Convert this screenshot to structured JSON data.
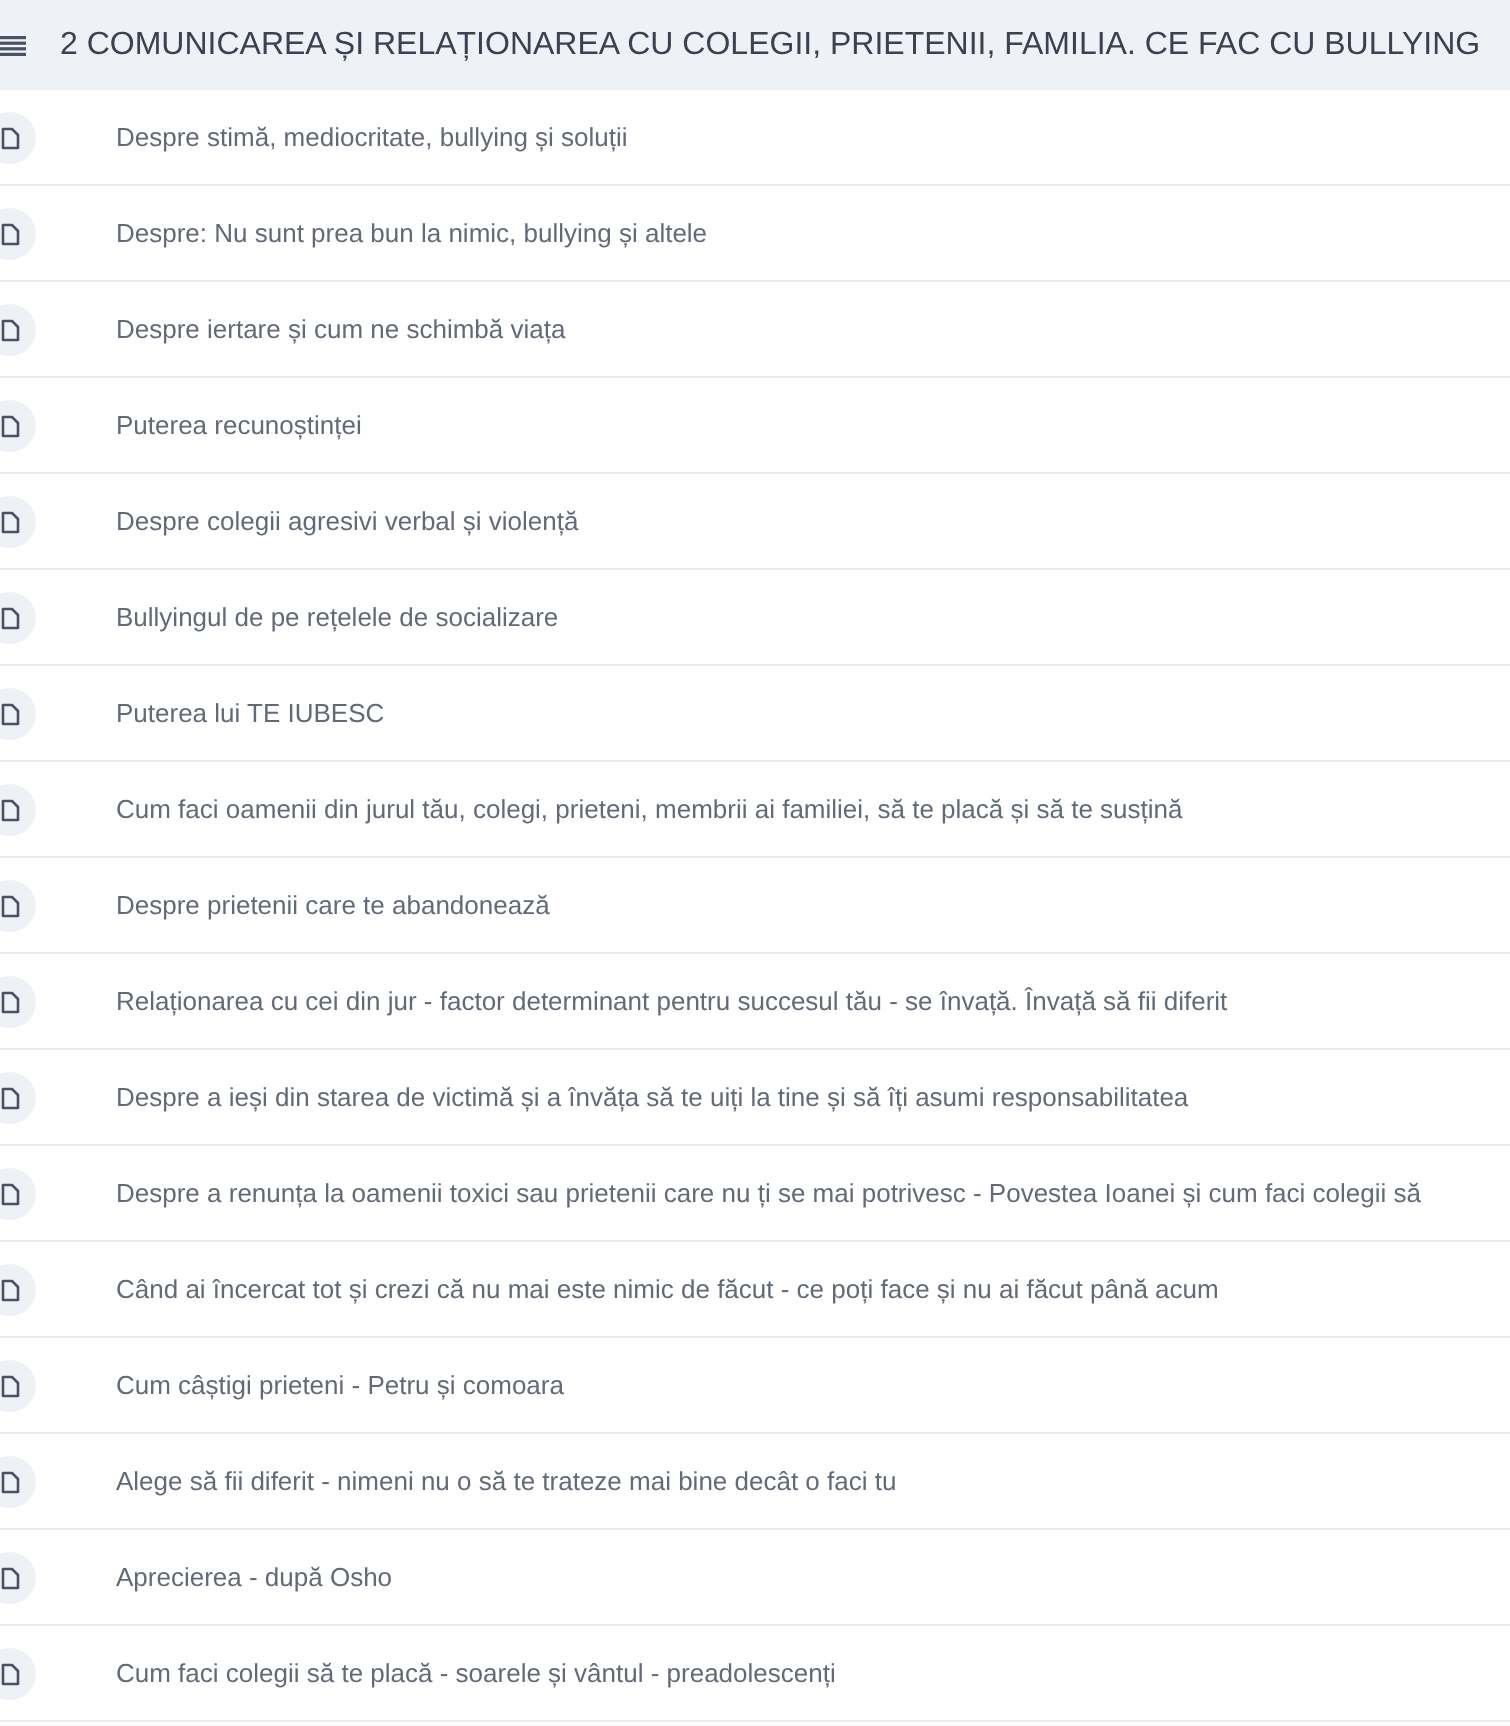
{
  "section": {
    "title": "2 COMUNICAREA ȘI RELAȚIONAREA CU COLEGII, PRIETENII, FAMILIA. CE FAC CU BULLYING"
  },
  "lessons": [
    {
      "title": "Despre stimă, mediocritate, bullying și soluții"
    },
    {
      "title": "Despre: Nu sunt prea bun la nimic, bullying și altele"
    },
    {
      "title": "Despre iertare și cum ne schimbă viața"
    },
    {
      "title": "Puterea recunoștinței"
    },
    {
      "title": "Despre colegii agresivi verbal și violență"
    },
    {
      "title": "Bullyingul de pe rețelele de socializare"
    },
    {
      "title": "Puterea lui TE IUBESC"
    },
    {
      "title": "Cum faci oamenii din jurul tău, colegi, prieteni, membrii ai familiei, să te placă și să te susțină"
    },
    {
      "title": "Despre prietenii care te abandonează"
    },
    {
      "title": "Relaționarea cu cei din jur - factor determinant pentru succesul tău - se învață. Învață să fii diferit"
    },
    {
      "title": "Despre a ieși din starea de victimă și a învăța să te uiți la tine și să îți asumi responsabilitatea"
    },
    {
      "title": "Despre a renunța la oamenii toxici sau prietenii care nu ți se mai potrivesc - Povestea Ioanei și cum faci colegii să"
    },
    {
      "title": "Când ai încercat tot și crezi că nu mai este nimic de făcut - ce poți face și nu ai făcut până acum"
    },
    {
      "title": "Cum câștigi prieteni - Petru și comoara"
    },
    {
      "title": "Alege să fii diferit - nimeni nu o să te trateze mai bine decât o faci tu"
    },
    {
      "title": "Aprecierea - după Osho"
    },
    {
      "title": "Cum faci colegii să te placă - soarele și vântul - preadolescenți"
    }
  ]
}
